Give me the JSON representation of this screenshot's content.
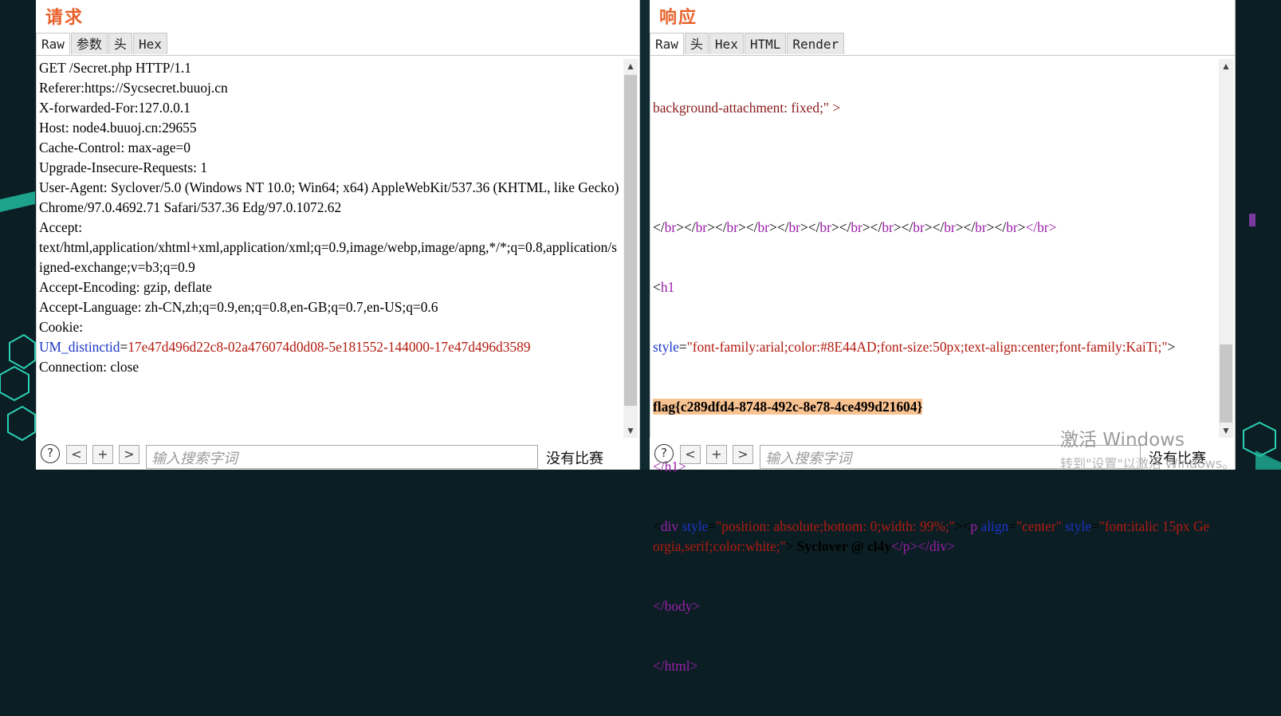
{
  "request": {
    "title": "请求",
    "tabs": [
      "Raw",
      "参数",
      "头",
      "Hex"
    ],
    "lines": {
      "l1": "GET /Secret.php HTTP/1.1",
      "l2": "Referer:https://Sycsecret.buuoj.cn",
      "l3": "X-forwarded-For:127.0.0.1",
      "l4": "Host: node4.buuoj.cn:29655",
      "l5": "Cache-Control: max-age=0",
      "l6": "Upgrade-Insecure-Requests: 1",
      "l7": "User-Agent: Syclover/5.0 (Windows NT 10.0; Win64; x64) AppleWebKit/537.36 (KHTML, like Gecko) Chrome/97.0.4692.71 Safari/537.36 Edg/97.0.1072.62",
      "l8": "Accept:",
      "l9": "text/html,application/xhtml+xml,application/xml;q=0.9,image/webp,image/apng,*/*;q=0.8,application/signed-exchange;v=b3;q=0.9",
      "l10": "Accept-Encoding: gzip, deflate",
      "l11": "Accept-Language: zh-CN,zh;q=0.9,en;q=0.8,en-GB;q=0.7,en-US;q=0.6",
      "l12": "Cookie:",
      "cookie_key": "UM_distinctid",
      "cookie_eq": "=",
      "cookie_val": "17e47d496d22c8-02a476074d0d08-5e181552-144000-17e47d496d3589",
      "l13": "Connection: close"
    },
    "search": {
      "help": "?",
      "prev": "<",
      "add": "+",
      "next": ">",
      "placeholder": "输入搜索字词",
      "status": "没有比赛"
    }
  },
  "response": {
    "title": "响应",
    "tabs": [
      "Raw",
      "头",
      "Hex",
      "HTML",
      "Render"
    ],
    "lines": {
      "r1": "background-attachment: fixed;\" >",
      "br_open": "</",
      "br_name": "br",
      "br_close": ">",
      "r_br_tail1": "</b",
      "r_br_tail2": "r>",
      "h1_open": "<",
      "h1_name": "h1",
      "style_attr": "style",
      "eq": "=",
      "h1_style": "\"font-family:arial;color:#8E44AD;font-size:50px;text-align:center;font-family:KaiTi;\"",
      "gt": ">",
      "flag": "flag{c289dfd4-8748-492c-8e78-4ce499d21604}",
      "h1_end": "</h1>",
      "div_lt": "<",
      "div_name": "div",
      "div_style": "\"position: absolute;bottom: 0;width: 99%;\"",
      "p_name": "p",
      "align_attr": "align",
      "align_val": "\"center\"",
      "p_style": "\"font:italic 15px Georgia,serif;color:white;\"",
      "p_text": " Syclover @ cl4y",
      "end_p": "</p></div>",
      "end_body": "</body>",
      "end_html": "</html>"
    },
    "search": {
      "help": "?",
      "prev": "<",
      "add": "+",
      "next": ">",
      "placeholder": "输入搜索字词",
      "status": "没有比赛"
    }
  },
  "watermark": {
    "line1": "激活 Windows",
    "line2": "转到\"设置\"以激活 Windows。"
  }
}
